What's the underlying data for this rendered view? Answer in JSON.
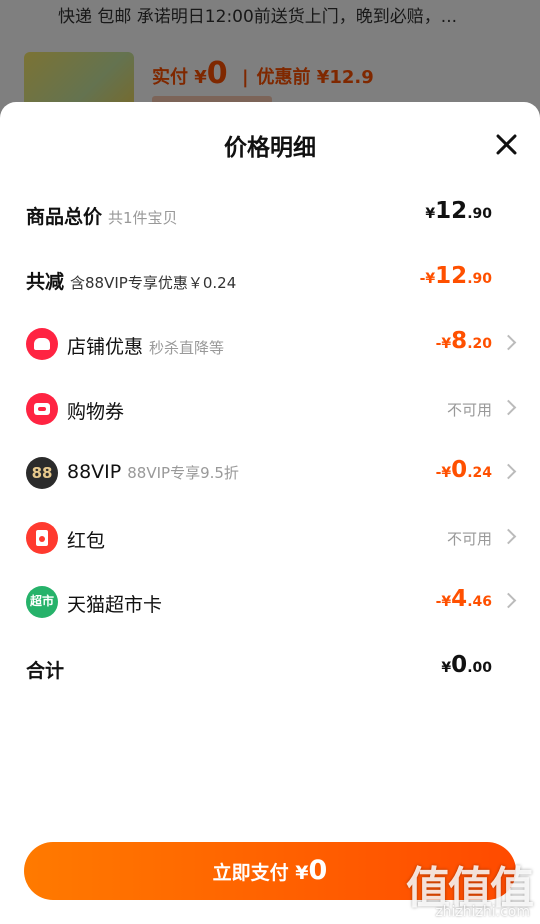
{
  "background": {
    "shipping_text": "快递 包邮 承诺明日12:00前送货上门，晚到必赔，...",
    "paid_label": "实付 ¥",
    "paid_value": "0",
    "before_label": "优惠前 ¥12.9"
  },
  "sheet": {
    "title": "价格明细"
  },
  "rows": {
    "subtotal": {
      "label": "商品总价",
      "sub": "共1件宝贝",
      "yen": "¥",
      "int": "12",
      "dec": ".90"
    },
    "discount": {
      "label": "共减",
      "sub": "含88VIP专享优惠￥0.24",
      "yen": "-¥",
      "int": "12",
      "dec": ".90"
    },
    "store": {
      "label": "店铺优惠",
      "sub": "秒杀直降等",
      "yen": "-¥",
      "int": "8",
      "dec": ".20",
      "icon": "shop-icon"
    },
    "coupon": {
      "label": "购物券",
      "value": "不可用",
      "icon": "ticket-icon"
    },
    "vip": {
      "label": "88VIP",
      "sub": "88VIP专享9.5折",
      "yen": "-¥",
      "int": "0",
      "dec": ".24",
      "icon_text": "88"
    },
    "redpack": {
      "label": "红包",
      "value": "不可用",
      "icon": "red-packet-icon"
    },
    "tmall": {
      "label": "天猫超市卡",
      "yen": "-¥",
      "int": "4",
      "dec": ".46",
      "icon_text": "超市"
    },
    "total": {
      "label": "合计",
      "yen": "¥",
      "int": "0",
      "dec": ".00"
    }
  },
  "pay_button": {
    "label": "立即支付 ¥",
    "amount": "0"
  },
  "watermark": {
    "text": "值值值",
    "sub": "zhizhizhi.com"
  },
  "colors": {
    "accent": "#ff5000",
    "button_start": "#ff7a00",
    "button_end": "#ff4a00"
  }
}
